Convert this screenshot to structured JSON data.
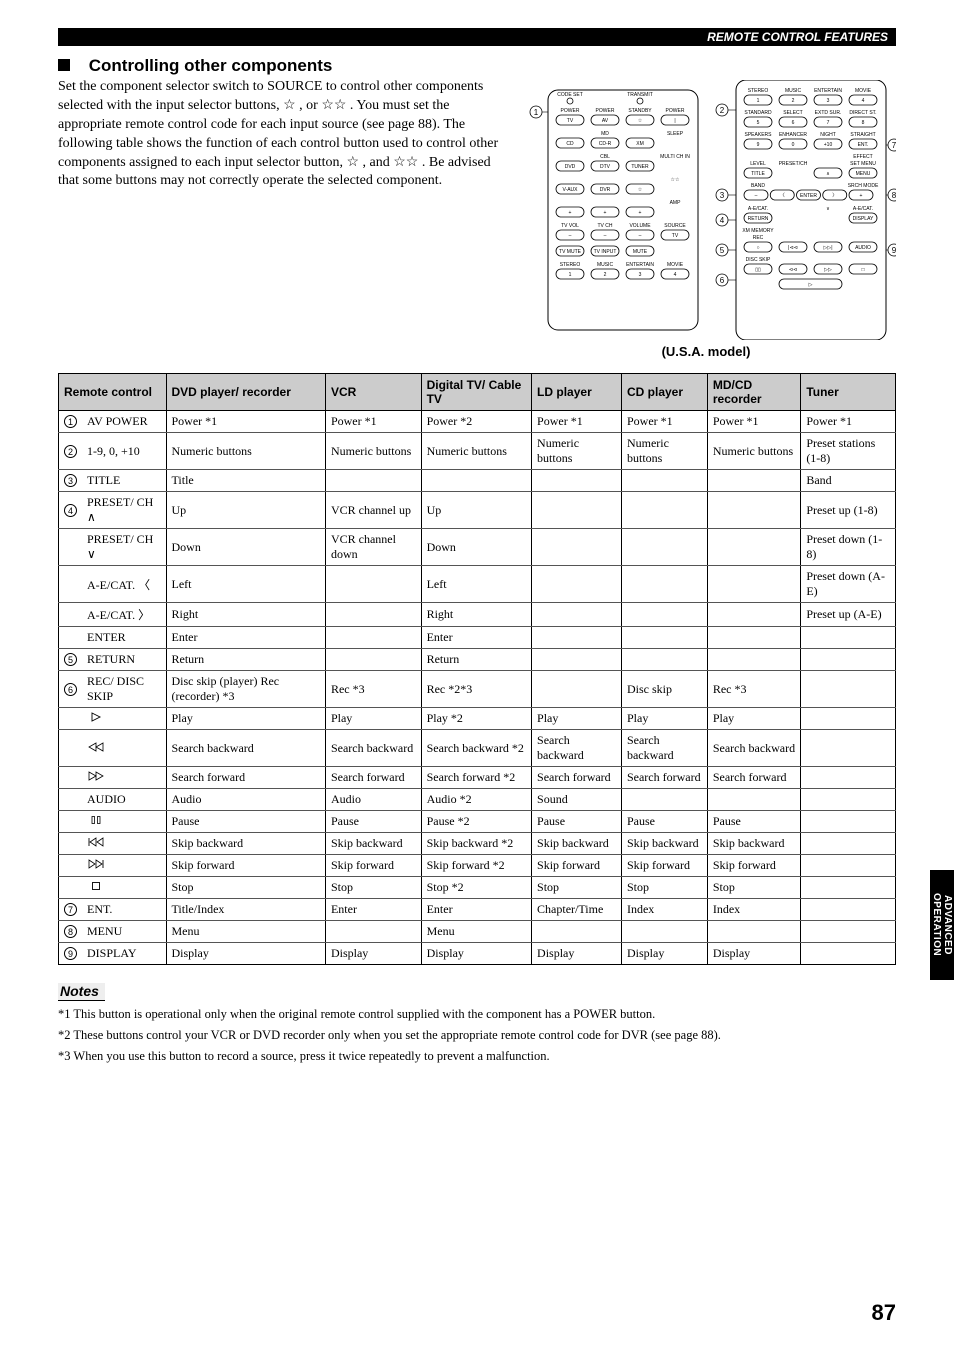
{
  "header": "REMOTE CONTROL FEATURES",
  "section_title": "Controlling other components",
  "intro": "Set the component selector switch to SOURCE to control other components selected with the input selector buttons, ☆ , or ☆☆ . You must set the appropriate remote control code for each input source (see page 88). The following table shows the function of each control button used to control other components assigned to each input selector button, ☆ , and ☆☆ . Be advised that some buttons may not correctly operate the selected component.",
  "model_caption": "(U.S.A. model)",
  "table": {
    "headers": [
      "Remote control",
      "DVD player/ recorder",
      "VCR",
      "Digital TV/ Cable TV",
      "LD player",
      "CD player",
      "MD/CD recorder",
      "Tuner"
    ],
    "rows": [
      {
        "num": "1",
        "name": "AV POWER",
        "cells": [
          "Power *1",
          "Power *1",
          "Power *2",
          "Power *1",
          "Power *1",
          "Power *1",
          "Power *1"
        ]
      },
      {
        "num": "2",
        "name": "1-9, 0, +10",
        "cells": [
          "Numeric buttons",
          "Numeric buttons",
          "Numeric buttons",
          "Numeric buttons",
          "Numeric buttons",
          "Numeric buttons",
          "Preset stations (1-8)"
        ]
      },
      {
        "num": "3",
        "name": "TITLE",
        "cells": [
          "Title",
          "",
          "",
          "",
          "",
          "",
          "Band"
        ]
      },
      {
        "num": "4",
        "name": "PRESET/ CH ∧",
        "cells": [
          "Up",
          "VCR channel up",
          "Up",
          "",
          "",
          "",
          "Preset up (1-8)"
        ]
      },
      {
        "num": "",
        "name": "PRESET/ CH ∨",
        "cells": [
          "Down",
          "VCR channel down",
          "Down",
          "",
          "",
          "",
          "Preset down (1-8)"
        ]
      },
      {
        "num": "",
        "name": "A-E/CAT. 〈",
        "cells": [
          "Left",
          "",
          "Left",
          "",
          "",
          "",
          "Preset down (A-E)"
        ]
      },
      {
        "num": "",
        "name": "A-E/CAT. 〉",
        "cells": [
          "Right",
          "",
          "Right",
          "",
          "",
          "",
          "Preset up (A-E)"
        ]
      },
      {
        "num": "",
        "name": "ENTER",
        "cells": [
          "Enter",
          "",
          "Enter",
          "",
          "",
          "",
          ""
        ]
      },
      {
        "num": "5",
        "name": "RETURN",
        "cells": [
          "Return",
          "",
          "Return",
          "",
          "",
          "",
          ""
        ]
      },
      {
        "num": "6",
        "name": "REC/ DISC SKIP",
        "cells": [
          "Disc skip (player) Rec (recorder) *3",
          "Rec *3",
          "Rec *2*3",
          "",
          "Disc skip",
          "Rec *3",
          ""
        ]
      },
      {
        "num": "",
        "name": "▷",
        "icon": "play",
        "cells": [
          "Play",
          "Play",
          "Play *2",
          "Play",
          "Play",
          "Play",
          ""
        ]
      },
      {
        "num": "",
        "name": "⊲⊲",
        "icon": "rew",
        "cells": [
          "Search backward",
          "Search backward",
          "Search backward *2",
          "Search backward",
          "Search backward",
          "Search backward",
          ""
        ]
      },
      {
        "num": "",
        "name": "▷▷",
        "icon": "ff",
        "cells": [
          "Search forward",
          "Search forward",
          "Search forward *2",
          "Search forward",
          "Search forward",
          "Search forward",
          ""
        ]
      },
      {
        "num": "",
        "name": "AUDIO",
        "cells": [
          "Audio",
          "Audio",
          "Audio *2",
          "Sound",
          "",
          "",
          ""
        ]
      },
      {
        "num": "",
        "name": "▯▯",
        "icon": "pause",
        "cells": [
          "Pause",
          "Pause",
          "Pause *2",
          "Pause",
          "Pause",
          "Pause",
          ""
        ]
      },
      {
        "num": "",
        "name": "|⊲⊲",
        "icon": "skipb",
        "cells": [
          "Skip backward",
          "Skip backward",
          "Skip backward *2",
          "Skip backward",
          "Skip backward",
          "Skip backward",
          ""
        ]
      },
      {
        "num": "",
        "name": "▷▷|",
        "icon": "skipf",
        "cells": [
          "Skip forward",
          "Skip forward",
          "Skip forward *2",
          "Skip forward",
          "Skip forward",
          "Skip forward",
          ""
        ]
      },
      {
        "num": "",
        "name": "□",
        "icon": "stop",
        "cells": [
          "Stop",
          "Stop",
          "Stop *2",
          "Stop",
          "Stop",
          "Stop",
          ""
        ]
      },
      {
        "num": "7",
        "name": "ENT.",
        "cells": [
          "Title/Index",
          "Enter",
          "Enter",
          "Chapter/Time",
          "Index",
          "Index",
          ""
        ]
      },
      {
        "num": "8",
        "name": "MENU",
        "cells": [
          "Menu",
          "",
          "Menu",
          "",
          "",
          "",
          ""
        ]
      },
      {
        "num": "9",
        "name": "DISPLAY",
        "cells": [
          "Display",
          "Display",
          "Display",
          "Display",
          "Display",
          "Display",
          ""
        ]
      }
    ]
  },
  "notes_title": "Notes",
  "notes": [
    "*1 This button is operational only when the original remote control supplied with the component has a POWER button.",
    "*2 These buttons control your VCR or DVD recorder only when you set the appropriate remote control code for DVR (see page 88).",
    "*3 When you use this button to record a source, press it twice repeatedly to prevent a malfunction."
  ],
  "page_number": "87",
  "side_tab": "ADVANCED OPERATION",
  "diagram": {
    "callouts_left": [
      "1",
      "2",
      "3",
      "4",
      "5",
      "6"
    ],
    "callouts_right": [
      "7",
      "8",
      "9"
    ],
    "left_rows": [
      [
        "CODE SET",
        "",
        "TRANSMIT",
        ""
      ],
      [
        "POWER",
        "POWER",
        "STANDBY",
        "POWER"
      ],
      [
        "TV",
        "AV",
        "☆",
        "|"
      ],
      [
        "",
        "MD",
        "",
        "SLEEP"
      ],
      [
        "CD",
        "CD-R",
        "XM",
        ""
      ],
      [
        "",
        "CBL",
        "",
        "MULTI CH IN"
      ],
      [
        "DVD",
        "DTV",
        "TUNER",
        ""
      ],
      [
        "",
        "",
        "",
        "☆☆"
      ],
      [
        "V-AUX",
        "DVR",
        "☆",
        ""
      ],
      [
        "",
        "",
        "",
        "AMP"
      ],
      [
        "+",
        "+",
        "+",
        ""
      ],
      [
        "TV VOL",
        "TV CH",
        "VOLUME",
        "SOURCE"
      ],
      [
        "–",
        "–",
        "–",
        "TV"
      ],
      [
        "TV MUTE",
        "TV INPUT",
        "MUTE",
        ""
      ],
      [
        "STEREO",
        "MUSIC",
        "ENTERTAIN",
        "MOVIE"
      ],
      [
        "1",
        "2",
        "3",
        "4"
      ]
    ],
    "right_rows": [
      [
        "STEREO",
        "MUSIC",
        "ENTERTAIN",
        "MOVIE"
      ],
      [
        "1",
        "2",
        "3",
        "4"
      ],
      [
        "STANDARD",
        "SELECT",
        "EXTD SUR.",
        "DIRECT ST."
      ],
      [
        "5",
        "6",
        "7",
        "8"
      ],
      [
        "SPEAKERS",
        "ENHANCER",
        "NIGHT",
        "STRAIGHT"
      ],
      [
        "9",
        "0",
        "+10",
        "ENT."
      ],
      [
        "",
        "",
        "",
        "EFFECT"
      ],
      [
        "LEVEL",
        "PRESET/CH",
        "",
        "SET MENU"
      ],
      [
        "TITLE",
        "",
        "∧",
        "MENU"
      ],
      [
        "BAND",
        "",
        "",
        "SRCH MODE"
      ],
      [
        "–",
        "〈",
        "ENTER",
        "〉",
        "+"
      ],
      [
        "A-E/CAT.",
        "",
        "∨",
        "A-E/CAT."
      ],
      [
        "RETURN",
        "",
        "",
        "DISPLAY"
      ],
      [
        "XM MEMORY",
        "",
        "",
        ""
      ],
      [
        "REC",
        "",
        "",
        ""
      ],
      [
        "○",
        "|⊲⊲",
        "▷▷|",
        "AUDIO"
      ],
      [
        "DISC SKIP",
        "",
        "",
        ""
      ],
      [
        "▯▯",
        "⊲⊲",
        "▷▷",
        "□"
      ],
      [
        "",
        "▷",
        "",
        ""
      ]
    ]
  }
}
